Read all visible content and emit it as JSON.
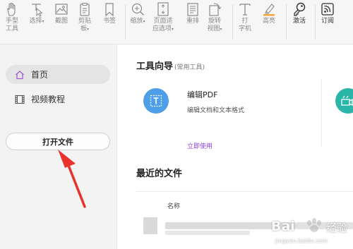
{
  "toolbar": {
    "items": [
      {
        "id": "hand",
        "label_line1": "手型",
        "label_line2": "工具",
        "icon": "hand-icon"
      },
      {
        "id": "select",
        "label_line1": "选择",
        "caret": "▾",
        "icon": "select-cursor-icon"
      },
      {
        "id": "screenshot",
        "label_line1": "截图",
        "icon": "image-icon"
      },
      {
        "id": "clipboard",
        "label_line1": "剪贴",
        "label_line2": "板",
        "caret": "▾",
        "icon": "clipboard-icon"
      },
      {
        "id": "bookmark",
        "label_line1": "书签",
        "icon": "bookmark-icon"
      },
      {
        "id": "zoom",
        "label_line1": "缩放",
        "caret": "▾",
        "icon": "zoom-icon"
      },
      {
        "id": "fit-page",
        "label_line1": "页面适",
        "label_line2": "应选项",
        "caret": "▾",
        "icon": "fit-page-icon"
      },
      {
        "id": "reflow",
        "label_line1": "重排",
        "icon": "reflow-icon"
      },
      {
        "id": "rotate",
        "label_line1": "旋转",
        "label_line2": "视图",
        "caret": "▾",
        "icon": "rotate-icon"
      },
      {
        "id": "typewriter",
        "label_line1": "打",
        "label_line2": "字机",
        "icon": "typewriter-icon"
      },
      {
        "id": "highlight",
        "label_line1": "高亮",
        "icon": "highlighter-icon"
      },
      {
        "id": "activate",
        "label_line1": "激活",
        "icon": "key-icon"
      },
      {
        "id": "subscribe",
        "label_line1": "订阅",
        "icon": "rss-icon"
      }
    ]
  },
  "sidebar": {
    "home_label": "首页",
    "video_label": "视频教程",
    "open_file_label": "打开文件"
  },
  "main": {
    "tools_title": "工具向导",
    "tools_subtitle": "(常用工具)",
    "tool_name": "编辑PDF",
    "tool_desc": "编辑文档和文本格式",
    "tool_link": "立即使用",
    "recent_title": "最近的文件",
    "col_name": "名称"
  },
  "watermark": {
    "brand": "Bai",
    "brand2": "经验",
    "url": "jingyan.baidu.com"
  },
  "colors": {
    "accent_link": "#8e44d6",
    "tool_blue": "#4f9ee8",
    "tool_teal": "#2bb5a8",
    "arrow_red": "#e8322b"
  }
}
